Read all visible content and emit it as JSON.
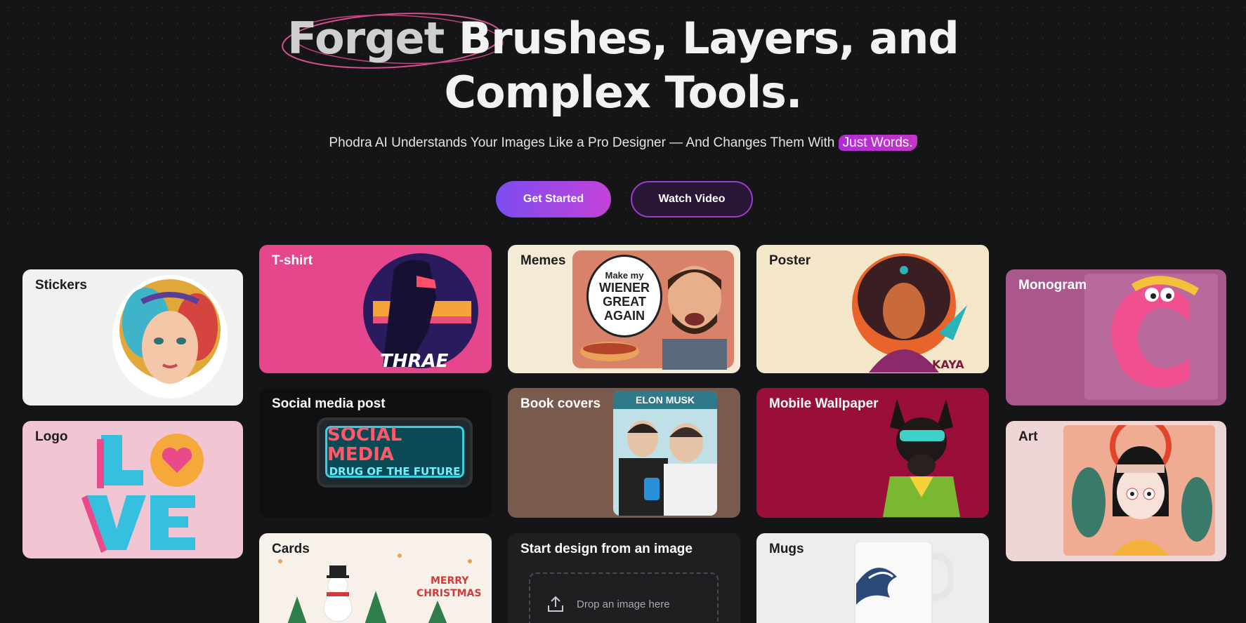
{
  "hero": {
    "headline_part1": "Forget",
    "headline_part2": " Brushes, Layers, and",
    "headline_line2": "Complex Tools.",
    "subtitle_main": "Phodra AI Understands Your Images Like a Pro Designer — And Changes Them With ",
    "subtitle_highlight": "Just Words.",
    "primary_button": "Get Started",
    "secondary_button": "Watch Video"
  },
  "cards": {
    "stickers": "Stickers",
    "logo": "Logo",
    "tshirt": "T-shirt",
    "tshirt_art_text": "THRAE",
    "social": "Social media post",
    "social_art_line1": "SOCIAL MEDIA",
    "social_art_line2": "DRUG OF THE FUTURE",
    "cards": "Cards",
    "cards_art_line1": "MERRY",
    "cards_art_line2": "CHRISTMAS",
    "memes": "Memes",
    "memes_bubble": [
      "Make my",
      "WIENER",
      "GREAT",
      "AGAIN"
    ],
    "book": "Book covers",
    "book_art_title": "ELON MUSK",
    "start_design": "Start design from an image",
    "drop_text": "Drop an image here",
    "poster": "Poster",
    "poster_art_text": "KAYA",
    "wallpaper": "Mobile Wallpaper",
    "mugs": "Mugs",
    "monogram": "Monogram",
    "art": "Art"
  },
  "colors": {
    "background": "#151517",
    "accent_purple": "#7c4cf0",
    "accent_pink": "#c443d8",
    "highlight": "#b02bd6"
  }
}
